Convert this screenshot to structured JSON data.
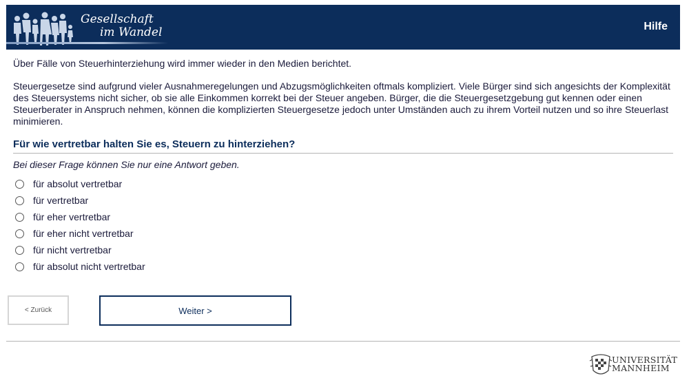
{
  "header": {
    "brand_line1": "Gesellschaft",
    "brand_line2": "im Wandel",
    "help_label": "Hilfe",
    "background_color": "#0c2d5b",
    "logo_icon": "people-silhouette-icon"
  },
  "intro": {
    "paragraph1": "Über Fälle von Steuerhinterziehung wird immer wieder in den Medien berichtet.",
    "paragraph2": "Steuergesetze sind aufgrund vieler Ausnahmeregelungen und Abzugsmöglichkeiten oftmals kompliziert. Viele Bürger sind sich angesichts der Komplexität des Steuersystems nicht sicher, ob sie alle Einkommen korrekt bei der Steuer angeben. Bürger, die die Steuergesetzgebung gut kennen oder einen Steuerberater in Anspruch nehmen, können die komplizierten Steuergesetze jedoch unter Umständen auch zu ihrem Vorteil nutzen und so ihre Steuerlast minimieren."
  },
  "question": {
    "text": "Für wie vertretbar halten Sie es, Steuern zu hinterziehen?",
    "hint": "Bei dieser Frage können Sie nur eine Antwort geben.",
    "options": [
      "für absolut vertretbar",
      "für vertretbar",
      "für eher vertretbar",
      "für eher nicht vertretbar",
      "für nicht vertretbar",
      "für absolut nicht vertretbar"
    ],
    "selected": null
  },
  "nav": {
    "back_label": "< Zurück",
    "next_label": "Weiter >"
  },
  "footer": {
    "university_line1": "UNIVERSITÄT",
    "university_line2": "MANNHEIM",
    "seal_icon": "university-seal-icon"
  },
  "colors": {
    "accent": "#0c2d5b",
    "text": "#1a1a3a",
    "divider": "#b4b4b4"
  }
}
